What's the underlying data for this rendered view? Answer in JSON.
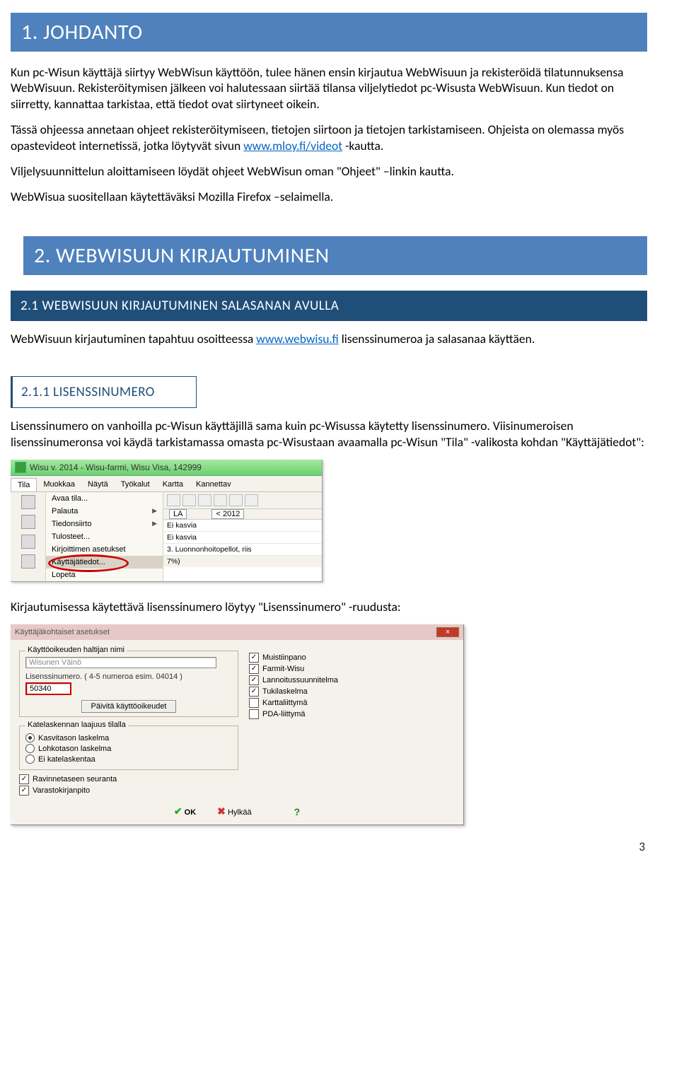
{
  "headings": {
    "h1": "1. JOHDANTO",
    "h2": "2. WEBWISUUN KIRJAUTUMINEN",
    "h2_1": "2.1 WEBWISUUN KIRJAUTUMINEN SALASANAN AVULLA",
    "h2_1_1": "2.1.1 LISENSSINUMERO"
  },
  "para": {
    "p1a": "Kun pc-Wisun käyttäjä siirtyy WebWisun käyttöön, tulee hänen ensin kirjautua WebWisuun ja rekisteröidä tilatunnuksensa WebWisuun. Rekisteröitymisen jälkeen voi halutessaan siirtää tilansa viljelytiedot pc-Wisusta WebWisuun. Kun tiedot on siirretty, kannattaa tarkistaa, että tiedot ovat siirtyneet oikein.",
    "p2a": "Tässä ohjeessa annetaan ohjeet rekisteröitymiseen, tietojen siirtoon ja tietojen tarkistamiseen. Ohjeista on olemassa myös opastevideot internetissä, jotka löytyvät sivun ",
    "p2link": "www.mloy.fi/videot",
    "p2b": " -kautta.",
    "p3": "Viljelysuunnittelun aloittamiseen löydät ohjeet WebWisun oman \"Ohjeet\" –linkin kautta.",
    "p4": "WebWisua suositellaan käytettäväksi Mozilla Firefox –selaimella.",
    "p5a": "WebWisuun kirjautuminen tapahtuu osoitteessa ",
    "p5link": "www.webwisu.fi",
    "p5b": " lisenssinumeroa ja salasanaa käyttäen.",
    "p6": "Lisenssinumero on vanhoilla pc-Wisun käyttäjillä sama kuin pc-Wisussa käytetty lisenssinumero. Viisinumeroisen lisenssinumeronsa voi käydä tarkistamassa omasta pc-Wisustaan avaamalla pc-Wisun \"Tila\" -valikosta kohdan \"Käyttäjätiedot\":",
    "p7": "Kirjautumisessa käytettävä lisenssinumero löytyy \"Lisenssinumero\" -ruudusta:"
  },
  "shot1": {
    "title": "Wisu v. 2014 - Wisu-farmi, Wisu Visa, 142999",
    "menubar": [
      "Tila",
      "Muokkaa",
      "Näytä",
      "Työkalut",
      "Kartta",
      "Kannettav"
    ],
    "menu": {
      "avaa": "Avaa tila...",
      "palauta": "Palauta",
      "tiedonsiirto": "Tiedonsiirto",
      "tulosteet": "Tulosteet...",
      "kirjoittimen": "Kirjoittimen asetukset",
      "kayttajatiedot": "Käyttäjätiedot...",
      "lopeta": "Lopeta"
    },
    "right": {
      "la": "LA",
      "year": "< 2012",
      "pct": "7%)",
      "rows": [
        "Ei kasvia",
        "Ei kasvia",
        "3. Luonnonhoitopellot, riis"
      ]
    }
  },
  "shot2": {
    "title": "Käyttäjäkohtaiset asetukset",
    "left": {
      "grp1": "Käyttöoikeuden haltijan nimi",
      "name": "Wisunen Väinö",
      "lic_label": "Lisenssinumero. ( 4-5 numeroa esim. 04014 )",
      "lic_val": "50340",
      "btn": "Päivitä käyttöoikeudet",
      "grp2": "Katelaskennan laajuus tilalla",
      "r1": "Kasvitason laskelma",
      "r2": "Lohkotason laskelma",
      "r3": "Ei katelaskentaa",
      "ck1": "Ravinnetaseen seuranta",
      "ck2": "Varastokirjanpito"
    },
    "right": {
      "c1": "Muistiinpano",
      "c2": "Farmit-Wisu",
      "c3": "Lannoitussuunnitelma",
      "c4": "Tukilaskelma",
      "c5": "Karttaliittymä",
      "c6": "PDA-liittymä"
    },
    "foot": {
      "ok": "OK",
      "cancel": "Hylkää"
    }
  },
  "page_number": "3"
}
